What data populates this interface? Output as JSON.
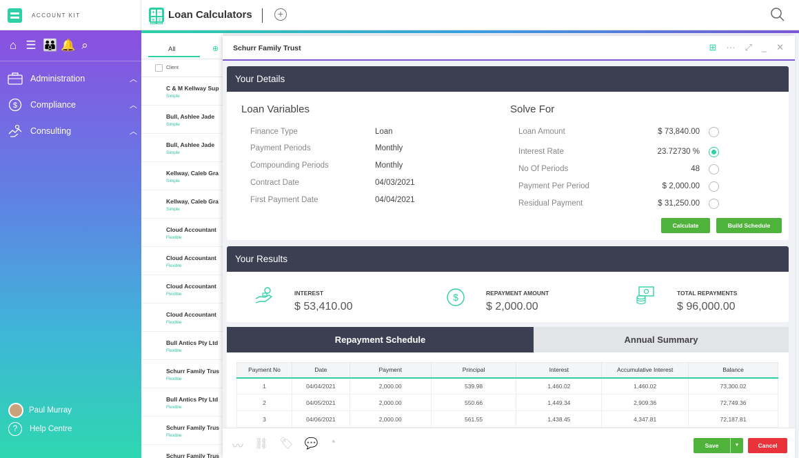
{
  "brand": {
    "name": "ACCOUNT KIT"
  },
  "header": {
    "title": "Loan Calculators"
  },
  "colors": {
    "accent": "#2ed1a6",
    "dark_header": "#3b3f51",
    "purple": "#7b57d6",
    "save": "#4fb23a",
    "cancel": "#e8333a"
  },
  "sidebar": {
    "top_icons": [
      "home-icon",
      "list-icon",
      "people-icon",
      "bell-icon",
      "search-icon"
    ],
    "items": [
      {
        "label": "Administration",
        "icon": "briefcase-icon"
      },
      {
        "label": "Compliance",
        "icon": "dollar-circle-icon"
      },
      {
        "label": "Consulting",
        "icon": "handshake-icon"
      }
    ],
    "user": "Paul Murray",
    "help": "Help Centre"
  },
  "client_list": {
    "tab_all": "All",
    "header": "Client",
    "rows": [
      {
        "name": "C & M Kellway Sup",
        "type": "Simple"
      },
      {
        "name": "Bull, Ashlee Jade",
        "type": "Simple"
      },
      {
        "name": "Bull, Ashlee Jade",
        "type": "Simple"
      },
      {
        "name": "Kellway, Caleb Gra",
        "type": "Simple"
      },
      {
        "name": "Kellway, Caleb Gra",
        "type": "Simple"
      },
      {
        "name": "Cloud Accountant",
        "type": "Flexible"
      },
      {
        "name": "Cloud Accountant",
        "type": "Flexible"
      },
      {
        "name": "Cloud Accountant",
        "type": "Flexible"
      },
      {
        "name": "Cloud Accountant",
        "type": "Flexible"
      },
      {
        "name": "Bull Antics Pty Ltd",
        "type": "Flexible"
      },
      {
        "name": "Schurr Family Trus",
        "type": "Flexible"
      },
      {
        "name": "Bull Antics Pty Ltd",
        "type": "Flexible"
      },
      {
        "name": "Schurr Family Trus",
        "type": "Flexible"
      },
      {
        "name": "Schurr Family Trus",
        "type": ""
      }
    ]
  },
  "panel": {
    "title": "Schurr Family Trust",
    "details": {
      "header": "Your Details",
      "loan_title": "Loan Variables",
      "solve_title": "Solve For",
      "variables": [
        {
          "label": "Finance Type",
          "value": "Loan"
        },
        {
          "label": "Payment Periods",
          "value": "Monthly"
        },
        {
          "label": "Compounding Periods",
          "value": "Monthly"
        },
        {
          "label": "Contract Date",
          "value": "04/03/2021"
        },
        {
          "label": "First Payment Date",
          "value": "04/04/2021"
        }
      ],
      "solve": [
        {
          "label": "Loan Amount",
          "value": "$ 73,840.00",
          "selected": false
        },
        {
          "label": "Interest Rate",
          "value": "23.72730 %",
          "selected": true
        },
        {
          "label": "No Of Periods",
          "value": "48",
          "selected": false
        },
        {
          "label": "Payment Per Period",
          "value": "$ 2,000.00",
          "selected": false
        },
        {
          "label": "Residual Payment",
          "value": "$ 31,250.00",
          "selected": false
        }
      ],
      "calculate": "Calculate",
      "build_schedule": "Build Schedule"
    },
    "results": {
      "header": "Your Results",
      "items": [
        {
          "label": "INTEREST",
          "value": "$ 53,410.00",
          "icon": "money-hand-icon"
        },
        {
          "label": "REPAYMENT AMOUNT",
          "value": "$ 2,000.00",
          "icon": "dollar-circle-icon"
        },
        {
          "label": "TOTAL REPAYMENTS",
          "value": "$ 96,000.00",
          "icon": "cash-stack-icon"
        }
      ]
    },
    "tabs": {
      "repayment": "Repayment Schedule",
      "annual": "Annual Summary"
    },
    "schedule": {
      "columns": [
        "Payment No",
        "Date",
        "Payment",
        "Principal",
        "Interest",
        "Accumulative Interest",
        "Balance"
      ],
      "rows": [
        [
          "1",
          "04/04/2021",
          "2,000.00",
          "539.98",
          "1,460.02",
          "1,460.02",
          "73,300.02"
        ],
        [
          "2",
          "04/05/2021",
          "2,000.00",
          "550.66",
          "1,449.34",
          "2,909.36",
          "72,749.36"
        ],
        [
          "3",
          "04/06/2021",
          "2,000.00",
          "561.55",
          "1,438.45",
          "4,347.81",
          "72,187.81"
        ]
      ]
    },
    "footer": {
      "save": "Save",
      "cancel": "Cancel"
    }
  }
}
